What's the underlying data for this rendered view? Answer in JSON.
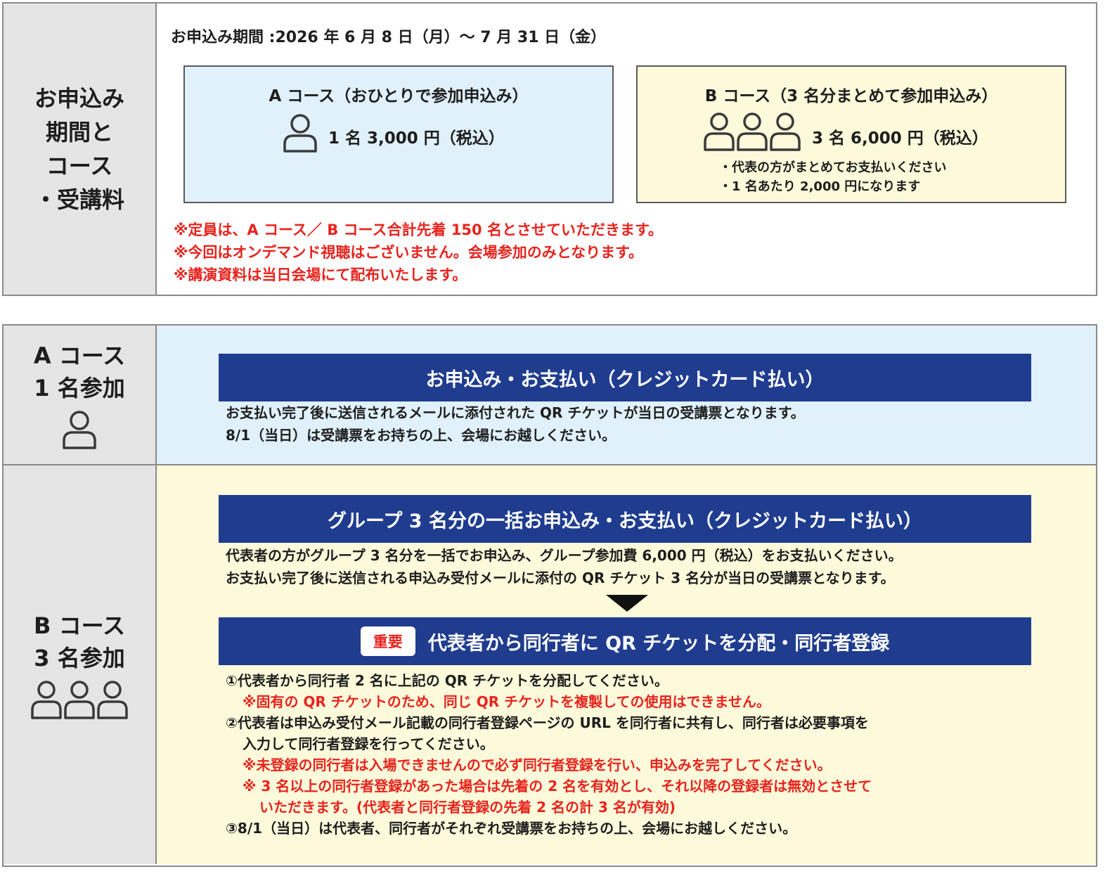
{
  "section1": {
    "label_lines": [
      "お申込み",
      "期間と",
      "コース",
      "・受講料"
    ],
    "period": "お申込み期間 :2026 年 6 月 8 日（月）〜 7 月 31 日（金）",
    "course_a": {
      "title": "A コース（おひとりで参加申込み）",
      "price": "1 名 3,000 円（税込）",
      "icon": "person-icon",
      "bg_color": "#e0f1fb"
    },
    "course_b": {
      "title": "B コース（3 名分まとめて参加申込み）",
      "price": "3 名 6,000 円（税込）",
      "icon": "three-persons-icon",
      "bg_color": "#fdfadb",
      "bullets": [
        "・代表の方がまとめてお支払いください",
        "・1 名あたり 2,000 円になります"
      ]
    },
    "notes": [
      "※定員は、A コース／ B コース合計先着 150 名とさせていただきます。",
      "※今回はオンデマンド視聴はございません。会場参加のみとなります。",
      "※講演資料は当日会場にて配布いたします。"
    ]
  },
  "section2": {
    "row_a": {
      "label_lines": [
        "A コース",
        "1 名参加"
      ],
      "icon": "person-icon",
      "bar_title": "お申込み・お支払い（クレジットカード払い）",
      "lines": [
        "お支払い完了後に送信されるメールに添付された QR チケットが当日の受講票となります。",
        "8/1（当日）は受講票をお持ちの上、会場にお越しください。"
      ]
    },
    "row_b": {
      "label_lines": [
        "B コース",
        "3 名参加"
      ],
      "icon": "three-persons-icon",
      "bar1_title": "グループ 3 名分の一括お申込み・お支払い（クレジットカード払い）",
      "lines1": [
        "代表者の方がグループ 3 名分を一括でお申込み、グループ参加費 6,000 円（税込）をお支払いください。",
        "お支払い完了後に送信される申込み受付メールに添付の QR チケット 3 名分が当日の受講票となります。"
      ],
      "badge": "重要",
      "bar2_title": "代表者から同行者に QR チケットを分配・同行者登録",
      "steps": [
        {
          "text": "①代表者から同行者 2 名に上記の QR チケットを分配してください。",
          "red": false,
          "indent": 0
        },
        {
          "text": "※固有の QR チケットのため、同じ QR チケットを複製しての使用はできません。",
          "red": true,
          "indent": 1
        },
        {
          "text": "②代表者は申込み受付メール記載の同行者登録ページの URL を同行者に共有し、同行者は必要事項を",
          "red": false,
          "indent": 0
        },
        {
          "text": "入力して同行者登録を行ってください。",
          "red": false,
          "indent": 1
        },
        {
          "text": "※未登録の同行者は入場できませんので必ず同行者登録を行い、申込みを完了してください。",
          "red": true,
          "indent": 1
        },
        {
          "text": "※ 3 名以上の同行者登録があった場合は先着の 2 名を有効とし、それ以降の登録者は無効とさせて",
          "red": true,
          "indent": 1
        },
        {
          "text": "いただきます。(代表者と同行者登録の先着 2 名の計 3 名が有効)",
          "red": true,
          "indent": 2
        },
        {
          "text": "③8/1（当日）は代表者、同行者がそれぞれ受講票をお持ちの上、会場にお越しください。",
          "red": false,
          "indent": 0
        }
      ]
    }
  },
  "colors": {
    "navy_bar": "#1f3c8f",
    "red_note": "#e8231d",
    "label_bg": "#e5e5e5"
  }
}
